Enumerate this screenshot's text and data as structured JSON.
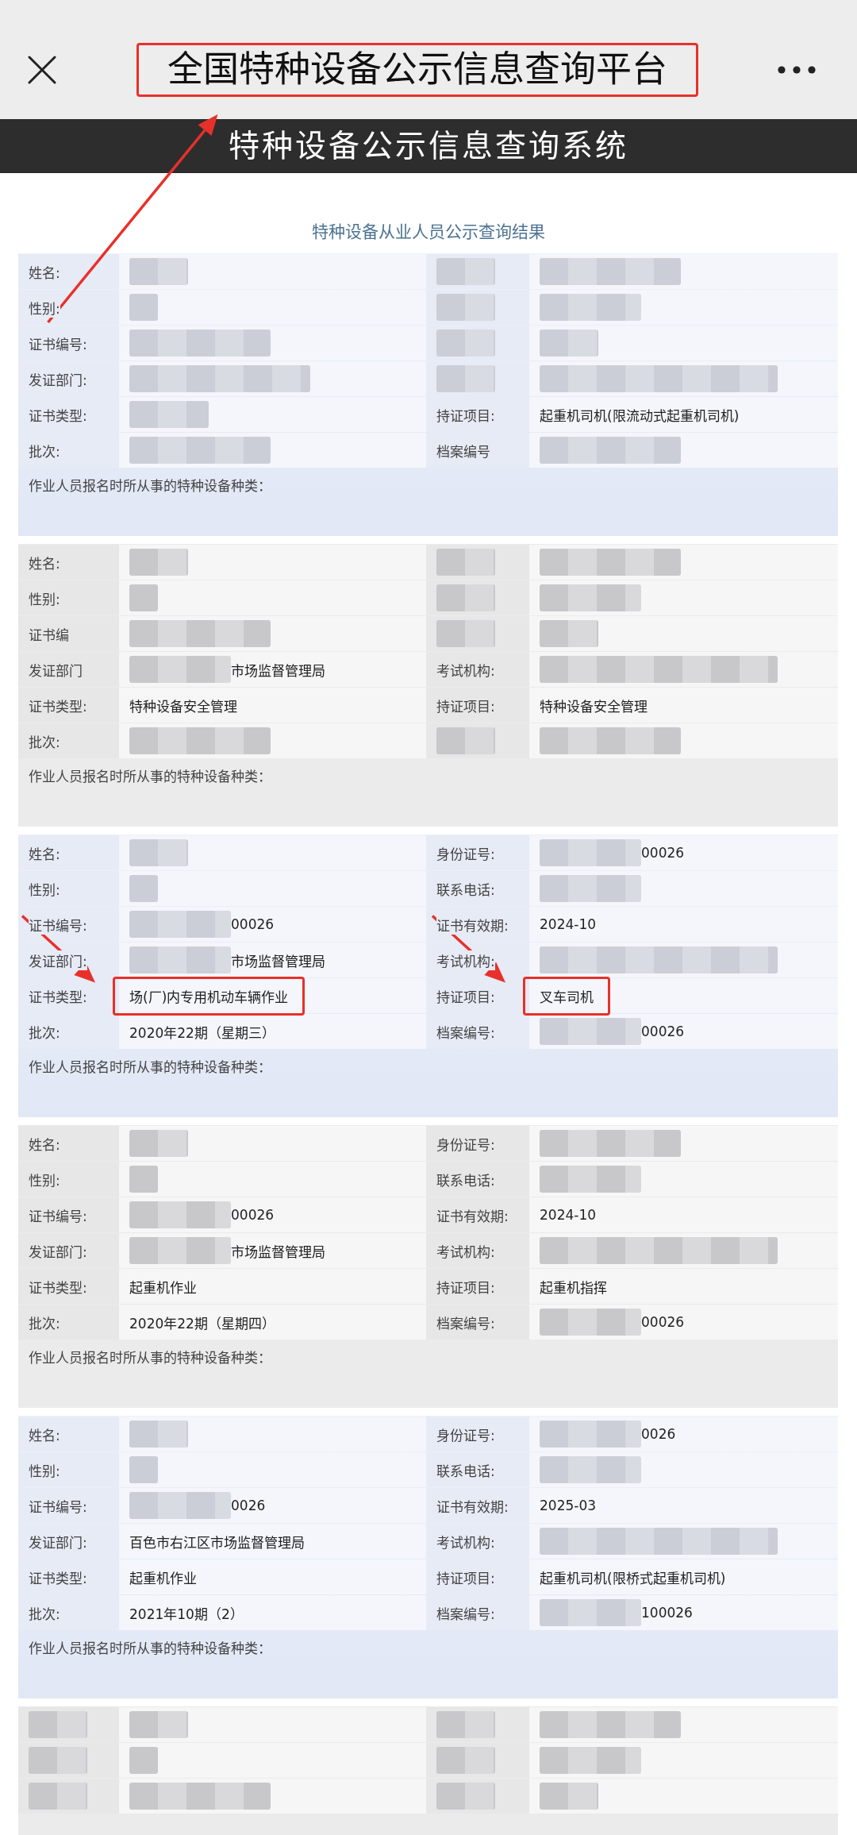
{
  "nav_bar": {
    "title": "全国特种设备公示信息查询平台",
    "highlighted": true
  },
  "banner": {
    "title": "特种设备公示信息查询系统"
  },
  "heading": "特种设备从业人员公示查询结果",
  "cards": [
    {
      "rows": [
        {
          "left": {
            "label": "姓名:",
            "value_masked": true,
            "highlighted": false
          },
          "right": {
            "label_masked": true,
            "value_masked": true,
            "highlighted": false
          }
        },
        {
          "left": {
            "label": "性别:",
            "value_masked": true,
            "highlighted": false
          },
          "right": {
            "label_masked": true,
            "value_masked": true,
            "highlighted": false
          }
        },
        {
          "left": {
            "label": "证书编号:",
            "value_masked": true,
            "highlighted": false
          },
          "right": {
            "label_masked": true,
            "value_masked": true,
            "highlighted": false
          }
        },
        {
          "left": {
            "label": "发证部门:",
            "value_masked": true,
            "highlighted": false
          },
          "right": {
            "label_masked": true,
            "value_masked": true,
            "highlighted": false
          }
        },
        {
          "left": {
            "label": "证书类型:",
            "value_masked": true,
            "highlighted": false
          },
          "right": {
            "label": "持证项目:",
            "value": "起重机司机(限流动式起重机司机)",
            "highlighted": false
          }
        },
        {
          "left": {
            "label": "批次:",
            "value_masked": true,
            "highlighted": false
          },
          "right": {
            "label": "档案编号",
            "value_masked": true,
            "highlighted": false
          }
        }
      ],
      "footer": "作业人员报名时所从事的特种设备种类："
    },
    {
      "rows": [
        {
          "left": {
            "label": "姓名:",
            "value_masked": true,
            "highlighted": false
          },
          "right": {
            "label_masked": true,
            "value_masked": true,
            "highlighted": false
          }
        },
        {
          "left": {
            "label": "性别:",
            "value_masked": true,
            "highlighted": false
          },
          "right": {
            "label_masked": true,
            "value_masked": true,
            "highlighted": false
          }
        },
        {
          "left": {
            "label": "证书编",
            "value_masked": true,
            "highlighted": false
          },
          "right": {
            "label_masked": true,
            "value_masked": true,
            "highlighted": false
          }
        },
        {
          "left": {
            "label": "发证部门",
            "value_masked": true,
            "value": "市场监督管理局",
            "highlighted": false
          },
          "right": {
            "label": "考试机构:",
            "value_masked": true,
            "highlighted": false
          }
        },
        {
          "left": {
            "label": "证书类型:",
            "value": "特种设备安全管理",
            "highlighted": false
          },
          "right": {
            "label": "持证项目:",
            "value": "特种设备安全管理",
            "highlighted": false
          }
        },
        {
          "left": {
            "label": "批次:",
            "value_masked": true,
            "highlighted": false
          },
          "right": {
            "label_masked": true,
            "value_masked": true,
            "highlighted": false
          }
        }
      ],
      "footer": "作业人员报名时所从事的特种设备种类："
    },
    {
      "rows": [
        {
          "left": {
            "label": "姓名:",
            "value_masked": true,
            "highlighted": false
          },
          "right": {
            "label": "身份证号:",
            "value_masked": true,
            "value": "00026",
            "highlighted": false
          }
        },
        {
          "left": {
            "label": "性别:",
            "value_masked": true,
            "highlighted": false
          },
          "right": {
            "label": "联系电话:",
            "value_masked": true,
            "highlighted": false
          }
        },
        {
          "left": {
            "label": "证书编号:",
            "value_masked": true,
            "value": "00026",
            "highlighted": false
          },
          "right": {
            "label": "证书有效期:",
            "value": "2024-10",
            "highlighted": false
          }
        },
        {
          "left": {
            "label": "发证部门:",
            "value_masked": true,
            "value": "市场监督管理局",
            "highlighted": false
          },
          "right": {
            "label": "考试机构:",
            "value_masked": true,
            "highlighted": false
          }
        },
        {
          "left": {
            "label": "证书类型:",
            "value": "场(厂)内专用机动车辆作业",
            "highlighted": true
          },
          "right": {
            "label": "持证项目:",
            "value": "叉车司机",
            "highlighted": true
          }
        },
        {
          "left": {
            "label": "批次:",
            "value": "2020年22期（星期三）",
            "highlighted": false
          },
          "right": {
            "label": "档案编号:",
            "value_masked": true,
            "value": "00026",
            "highlighted": false
          }
        }
      ],
      "footer": "作业人员报名时所从事的特种设备种类："
    },
    {
      "rows": [
        {
          "left": {
            "label": "姓名:",
            "value_masked": true,
            "highlighted": false
          },
          "right": {
            "label": "身份证号:",
            "value_masked": true,
            "highlighted": false
          }
        },
        {
          "left": {
            "label": "性别:",
            "value_masked": true,
            "highlighted": false
          },
          "right": {
            "label": "联系电话:",
            "value_masked": true,
            "highlighted": false
          }
        },
        {
          "left": {
            "label": "证书编号:",
            "value_masked": true,
            "value": "00026",
            "highlighted": false
          },
          "right": {
            "label": "证书有效期:",
            "value": "2024-10",
            "highlighted": false
          }
        },
        {
          "left": {
            "label": "发证部门:",
            "value_masked": true,
            "value": "市场监督管理局",
            "highlighted": false
          },
          "right": {
            "label": "考试机构:",
            "value_masked": true,
            "highlighted": false
          }
        },
        {
          "left": {
            "label": "证书类型:",
            "value": "起重机作业",
            "highlighted": false
          },
          "right": {
            "label": "持证项目:",
            "value": "起重机指挥",
            "highlighted": false
          }
        },
        {
          "left": {
            "label": "批次:",
            "value": "2020年22期（星期四）",
            "highlighted": false
          },
          "right": {
            "label": "档案编号:",
            "value_masked": true,
            "value": "00026",
            "highlighted": false
          }
        }
      ],
      "footer": "作业人员报名时所从事的特种设备种类："
    },
    {
      "rows": [
        {
          "left": {
            "label": "姓名:",
            "value_masked": true,
            "highlighted": false
          },
          "right": {
            "label": "身份证号:",
            "value_masked": true,
            "value": "0026",
            "highlighted": false
          }
        },
        {
          "left": {
            "label": "性别:",
            "value_masked": true,
            "highlighted": false
          },
          "right": {
            "label": "联系电话:",
            "value_masked": true,
            "highlighted": false
          }
        },
        {
          "left": {
            "label": "证书编号:",
            "value_masked": true,
            "value": "0026",
            "highlighted": false
          },
          "right": {
            "label": "证书有效期:",
            "value": "2025-03",
            "highlighted": false
          }
        },
        {
          "left": {
            "label": "发证部门:",
            "value": "百色市右江区市场监督管理局",
            "highlighted": false
          },
          "right": {
            "label": "考试机构:",
            "value_masked": true,
            "highlighted": false
          }
        },
        {
          "left": {
            "label": "证书类型:",
            "value": "起重机作业",
            "highlighted": false
          },
          "right": {
            "label": "持证项目:",
            "value": "起重机司机(限桥式起重机司机)",
            "highlighted": false
          }
        },
        {
          "left": {
            "label": "批次:",
            "value": "2021年10期（2）",
            "highlighted": false
          },
          "right": {
            "label": "档案编号:",
            "value_masked": true,
            "value": "100026",
            "highlighted": false
          }
        }
      ],
      "footer": "作业人员报名时所从事的特种设备种类："
    },
    {
      "rows": [
        {
          "left": {
            "label_masked": true,
            "value_masked": true,
            "highlighted": false
          },
          "right": {
            "label_masked": true,
            "value_masked": true,
            "highlighted": false
          }
        },
        {
          "left": {
            "label_masked": true,
            "value_masked": true,
            "highlighted": false
          },
          "right": {
            "label_masked": true,
            "value_masked": true,
            "highlighted": false
          }
        },
        {
          "left": {
            "label_masked": true,
            "value_masked": true,
            "highlighted": false
          },
          "right": {
            "label_masked": true,
            "value_masked": true,
            "highlighted": false
          }
        }
      ]
    }
  ]
}
